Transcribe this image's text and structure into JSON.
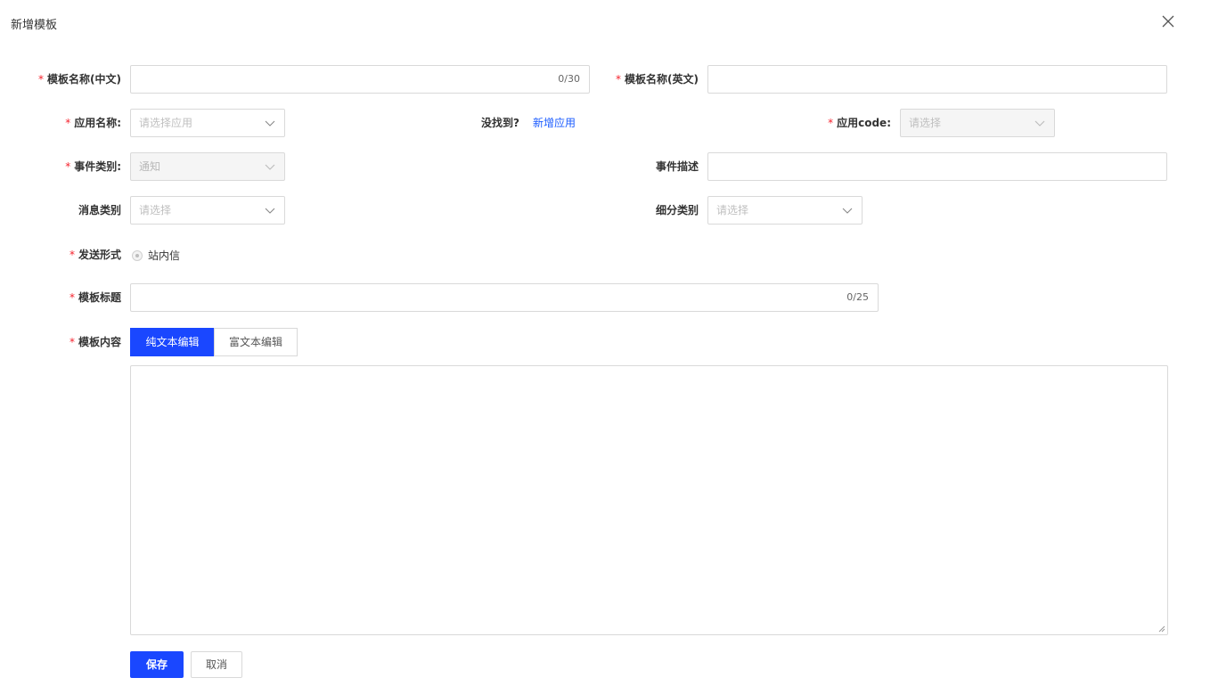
{
  "dialog": {
    "title": "新增模板"
  },
  "form": {
    "name_cn": {
      "label": "模板名称(中文)",
      "counter": "0/30"
    },
    "name_en": {
      "label": "模板名称(英文)"
    },
    "app_name": {
      "label": "应用名称:",
      "placeholder": "请选择应用"
    },
    "not_found": {
      "text": "没找到?",
      "link": "新增应用"
    },
    "app_code": {
      "label": "应用code:",
      "placeholder": "请选择"
    },
    "event_type": {
      "label": "事件类别:",
      "value": "通知"
    },
    "event_desc": {
      "label": "事件描述"
    },
    "msg_type": {
      "label": "消息类别",
      "placeholder": "请选择"
    },
    "sub_type": {
      "label": "细分类别",
      "placeholder": "请选择"
    },
    "send_form": {
      "label": "发送形式",
      "option": "站内信"
    },
    "tpl_title": {
      "label": "模板标题",
      "counter": "0/25"
    },
    "tpl_content": {
      "label": "模板内容",
      "tabs": [
        "纯文本编辑",
        "富文本编辑"
      ],
      "active_tab": 0
    },
    "required_mark": "*"
  },
  "buttons": {
    "save": "保存",
    "cancel": "取消"
  },
  "colors": {
    "primary": "#1a47ff",
    "link": "#1a5bff",
    "required": "#f5222d",
    "border": "#d9d9d9"
  },
  "icons": {
    "close": "close-icon",
    "chevron": "chevron-down-icon",
    "resize": "resize-handle-icon"
  }
}
